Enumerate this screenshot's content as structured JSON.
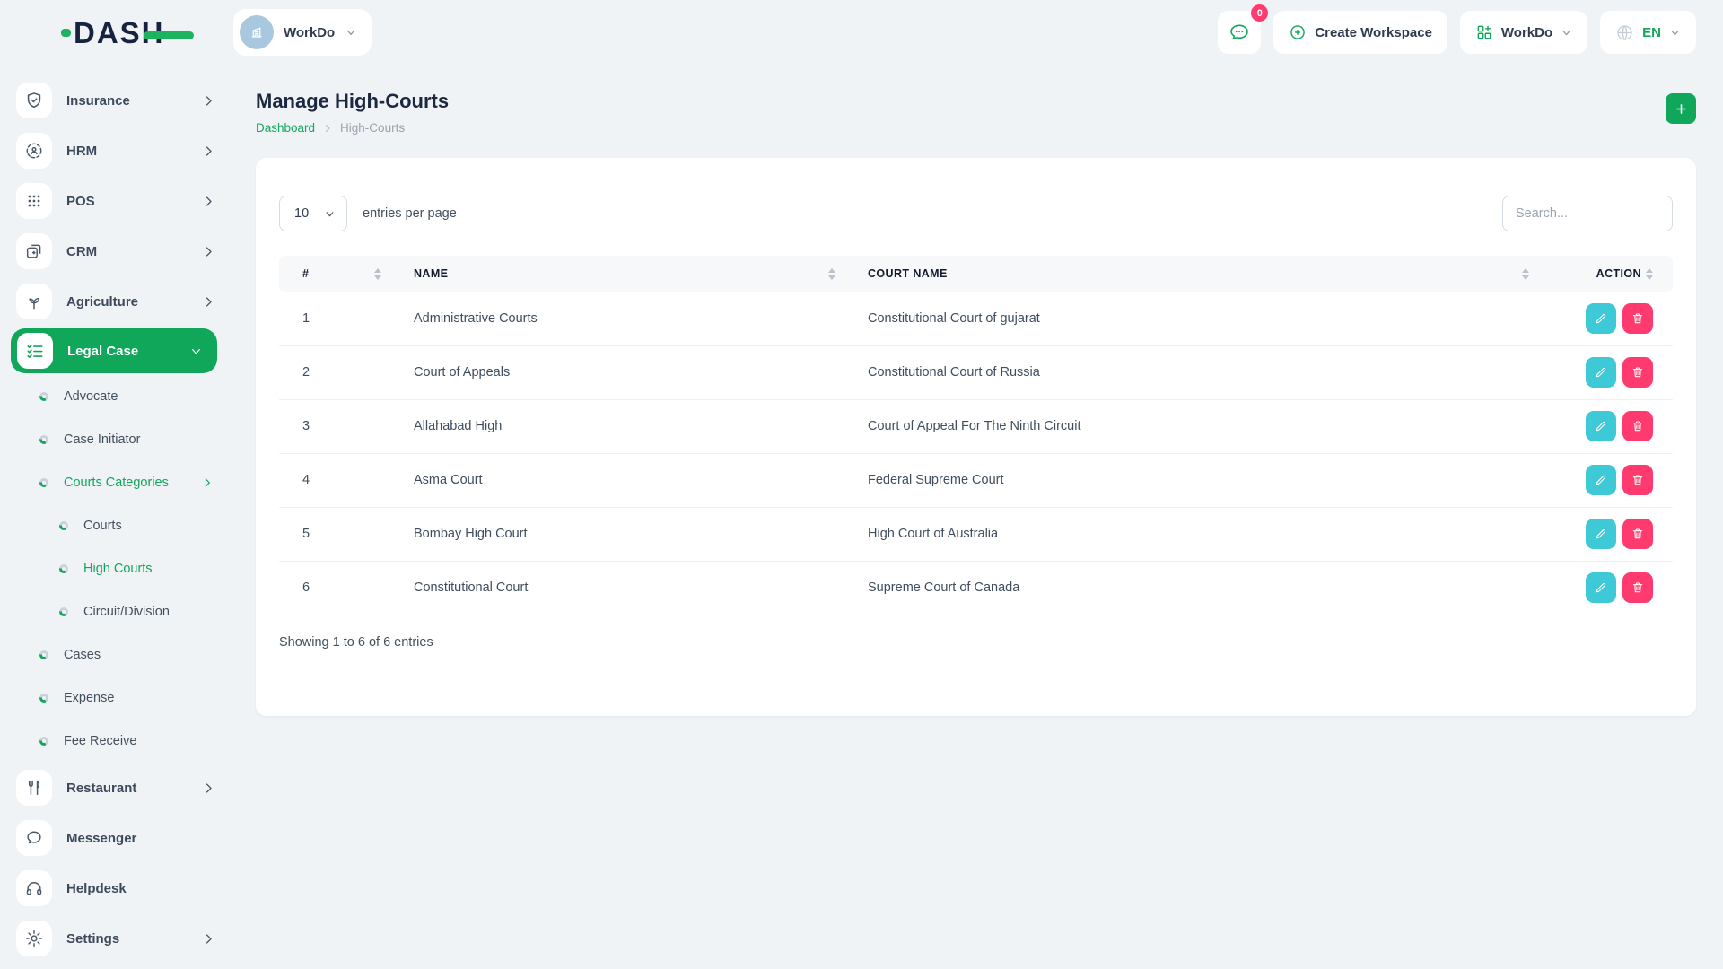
{
  "brand": {
    "logo_text": "DASH"
  },
  "topbar": {
    "workspace_pill": "WorkDo",
    "messages_badge": "0",
    "create_workspace": "Create Workspace",
    "workspace_dropdown": "WorkDo",
    "language": "EN"
  },
  "sidebar": {
    "insurance": "Insurance",
    "hrm": "HRM",
    "pos": "POS",
    "crm": "CRM",
    "agriculture": "Agriculture",
    "legal_case": "Legal Case",
    "advocate": "Advocate",
    "case_initiator": "Case Initiator",
    "courts_categories": "Courts Categories",
    "courts": "Courts",
    "high_courts": "High Courts",
    "circuit_division": "Circuit/Division",
    "cases": "Cases",
    "expense": "Expense",
    "fee_receive": "Fee Receive",
    "restaurant": "Restaurant",
    "messenger": "Messenger",
    "helpdesk": "Helpdesk",
    "settings": "Settings"
  },
  "page": {
    "title": "Manage High-Courts",
    "breadcrumb_home": "Dashboard",
    "breadcrumb_current": "High-Courts"
  },
  "table": {
    "entries_value": "10",
    "entries_label": "entries per page",
    "search_placeholder": "Search...",
    "columns": [
      "#",
      "NAME",
      "COURT NAME",
      "ACTION"
    ],
    "rows": [
      {
        "num": "1",
        "name": "Administrative Courts",
        "court": "Constitutional Court of gujarat"
      },
      {
        "num": "2",
        "name": "Court of Appeals",
        "court": "Constitutional Court of Russia"
      },
      {
        "num": "3",
        "name": "Allahabad High",
        "court": "Court of Appeal For The Ninth Circuit"
      },
      {
        "num": "4",
        "name": "Asma Court",
        "court": "Federal Supreme Court"
      },
      {
        "num": "5",
        "name": "Bombay High Court",
        "court": "High Court of Australia"
      },
      {
        "num": "6",
        "name": "Constitutional Court",
        "court": "Supreme Court of Canada"
      }
    ],
    "footer": "Showing 1 to 6 of 6 entries"
  },
  "colors": {
    "primary_green": "#11a75b",
    "edit_teal": "#3ec9d6",
    "delete_pink": "#ff3a6e",
    "badge_pink": "#ff3a6e",
    "avatar_blue": "#a7c8de"
  }
}
